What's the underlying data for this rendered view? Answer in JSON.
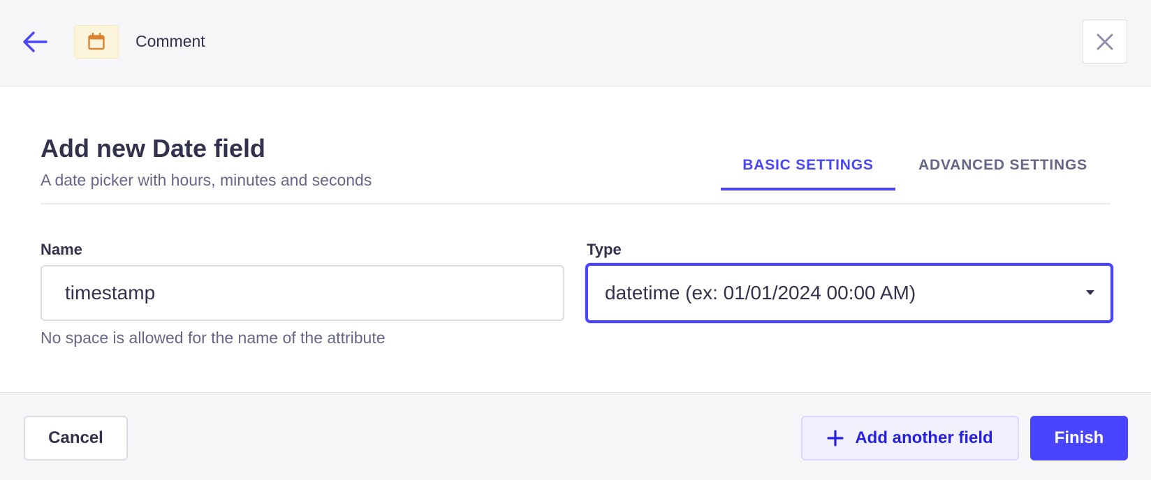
{
  "header": {
    "breadcrumb": "Comment",
    "icons": {
      "back": "arrow-left-icon",
      "type": "calendar-icon",
      "close": "close-icon"
    }
  },
  "form": {
    "title": "Add new Date field",
    "subtitle": "A date picker with hours, minutes and seconds",
    "tabs": [
      {
        "label": "BASIC SETTINGS",
        "active": true
      },
      {
        "label": "ADVANCED SETTINGS",
        "active": false
      }
    ],
    "name": {
      "label": "Name",
      "value": "timestamp",
      "hint": "No space is allowed for the name of the attribute"
    },
    "type": {
      "label": "Type",
      "value": "datetime (ex: 01/01/2024 00:00 AM)"
    }
  },
  "footer": {
    "cancel_label": "Cancel",
    "add_label": "Add another field",
    "finish_label": "Finish"
  },
  "colors": {
    "primary": "#4945ff",
    "badge_bg": "#fdf4dc",
    "badge_icon": "#d9822f",
    "text": "#32324d",
    "muted": "#666687"
  }
}
